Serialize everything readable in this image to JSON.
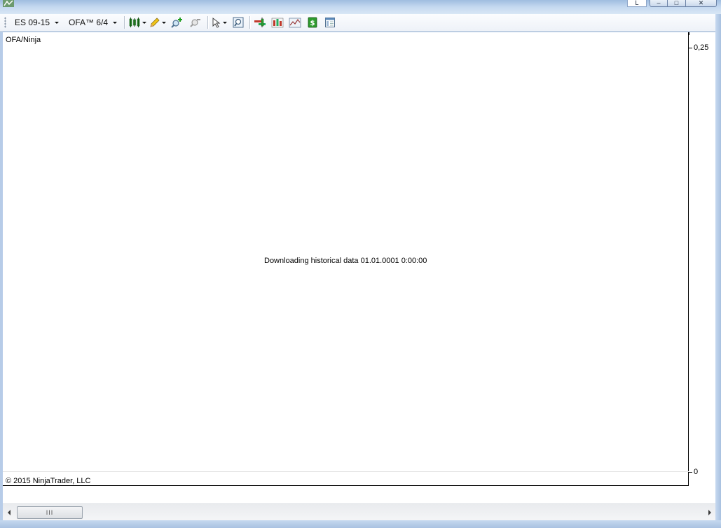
{
  "window": {
    "caption_buttons": {
      "extra_label": "L",
      "minimize": "–",
      "maximize": "□",
      "close": "✕"
    },
    "app_icon": "ninjatrader-icon"
  },
  "toolbar": {
    "instrument": "ES 09-15",
    "template": "OFA™ 6/4",
    "buttons": [
      {
        "name": "bar-type-icon",
        "has_dropdown": true
      },
      {
        "name": "drawing-tool-icon",
        "has_dropdown": true
      },
      {
        "name": "zoom-in-icon",
        "has_dropdown": false
      },
      {
        "name": "zoom-out-icon",
        "has_dropdown": false
      },
      {
        "name": "cursor-icon",
        "has_dropdown": true
      },
      {
        "name": "data-box-icon",
        "has_dropdown": false
      },
      {
        "name": "order-entry-icon",
        "has_dropdown": false
      },
      {
        "name": "indicators-icon",
        "has_dropdown": false
      },
      {
        "name": "strategies-icon",
        "has_dropdown": false
      },
      {
        "name": "dollar-icon",
        "has_dropdown": false
      },
      {
        "name": "properties-icon",
        "has_dropdown": false
      }
    ]
  },
  "chart": {
    "instrument_label": "OFA/Ninja",
    "status_message": "Downloading historical data 01.01.0001 0:00:00",
    "copyright": "© 2015 NinjaTrader, LLC",
    "y_axis": {
      "ticks": [
        "0,25",
        "0"
      ]
    }
  },
  "scrollbar": {
    "thumb_grip": "III"
  },
  "colors": {
    "chart_background": "#ffffff",
    "axis_line": "#000000",
    "window_frame": "#a9c4e4"
  }
}
